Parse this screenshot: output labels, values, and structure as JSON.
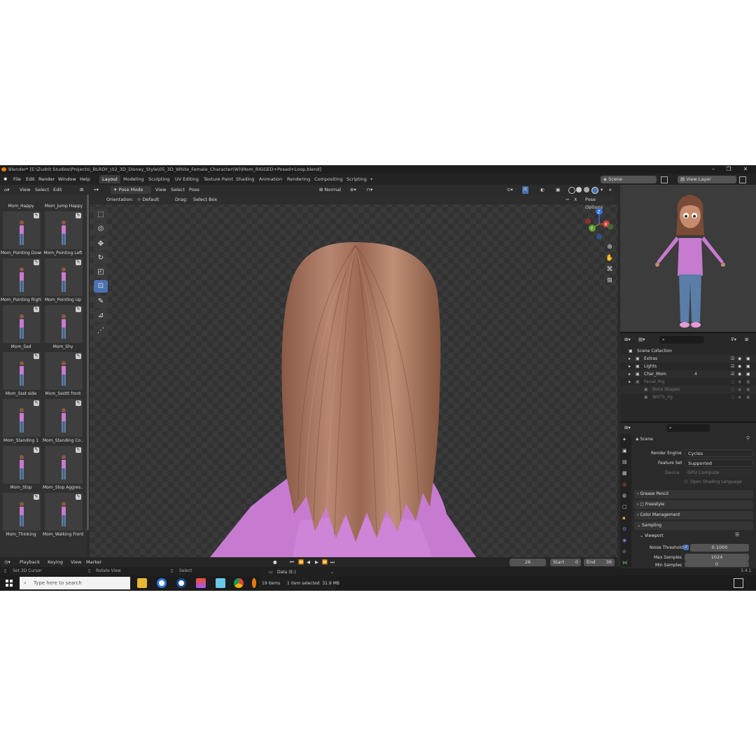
{
  "window": {
    "title": "Blender* [E:\\Zudrit Studios\\Projects\\_BLRDY_\\02_3D_Disney_Style\\05_3D_White_Female_Character(W)\\Mom_RIGGED+Posed+Loop.blend]"
  },
  "menu": [
    "File",
    "Edit",
    "Render",
    "Window",
    "Help"
  ],
  "workspaces": [
    "Layout",
    "Modeling",
    "Sculpting",
    "UV Editing",
    "Texture Paint",
    "Shading",
    "Animation",
    "Rendering",
    "Compositing",
    "Scripting"
  ],
  "workspaces_plus": "+",
  "scene": {
    "name": "Scene",
    "view_layer": "View Layer"
  },
  "asset_browser": {
    "menu": [
      "View",
      "Select",
      "Edit"
    ],
    "top_labels": [
      "Mom_Happy",
      "Mom_Jump Happy"
    ],
    "thumbs": [
      "Mom_Pointing Down",
      "Mom_Pointing Left",
      "Mom_Pointing Right",
      "Mom_Pointing Up",
      "Mom_Sad",
      "Mom_Shy",
      "Mom_Ssst side",
      "Mom_Sssttt front",
      "Mom_Standing 1",
      "Mom_Standing Co...",
      "Mom_Stop",
      "Mom_Stop Aggres...",
      "Mom_Thinking",
      "Mom_Walking Front"
    ]
  },
  "viewport": {
    "mode": "Pose Mode",
    "menu": [
      "View",
      "Select",
      "Pose"
    ],
    "transform": "Normal",
    "orientation_label": "Orientation:",
    "orientation_value": "Default",
    "drag_label": "Drag:",
    "drag_value": "Select Box",
    "pose_options": "Pose Options",
    "x_label": "X",
    "gizmo": {
      "z": "Z",
      "y": "Y",
      "x": "X"
    }
  },
  "timeline": {
    "menu": [
      "Playback",
      "Keying",
      "View",
      "Marker"
    ],
    "current_frame": "26",
    "start_label": "Start",
    "start": "0",
    "end_label": "End",
    "end": "36"
  },
  "status": {
    "left": "Set 3D Cursor",
    "middle": "Rotate View",
    "right": "Select",
    "version": "3.4.1"
  },
  "outliner": {
    "root": "Scene Collection",
    "items": [
      {
        "name": "Extras",
        "indent": 1
      },
      {
        "name": "Lights",
        "indent": 1
      },
      {
        "name": "Char_Mom",
        "indent": 1
      },
      {
        "name": "Facial_Rig",
        "indent": 1
      },
      {
        "name": "Bone Shapes",
        "indent": 2
      },
      {
        "name": "WGTS_rig",
        "indent": 2
      }
    ],
    "char_mom_count": "4"
  },
  "properties": {
    "scene_label": "Scene",
    "render_engine_label": "Render Engine",
    "render_engine": "Cycles",
    "feature_set_label": "Feature Set",
    "feature_set": "Supported",
    "device_label": "Device",
    "device": "GPU Compute",
    "osl_label": "Open Shading Language",
    "sections": [
      "Grease Pencil",
      "Freestyle",
      "Color Management",
      "Sampling"
    ],
    "viewport_label": "Viewport",
    "noise_threshold_label": "Noise Threshold",
    "noise_threshold": "0.1000",
    "max_samples_label": "Max Samples",
    "max_samples": "1024",
    "min_samples_label": "Min Samples",
    "min_samples": "0"
  },
  "taskbar": {
    "search_placeholder": "Type here to search"
  },
  "explorer": {
    "drive": "Data (E:)",
    "items": "19 items",
    "selected": "1 item selected  31.9 MB"
  },
  "colors": {
    "accent": "#4a72b0",
    "shirt": "#c77bd0",
    "hair": "#a8755e"
  }
}
